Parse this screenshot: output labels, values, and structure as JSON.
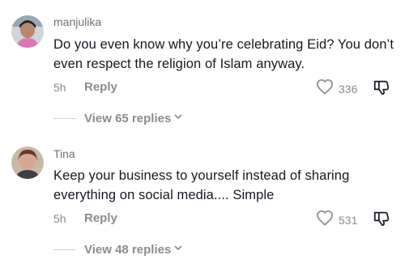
{
  "comments": [
    {
      "username": "manjulika",
      "text": "Do you even know why you’re celebrating Eid? You don’t even respect the religion of Islam anyway.",
      "time": "5h",
      "reply_label": "Reply",
      "likes": "336",
      "view_replies": "View 65 replies",
      "icons": [
        "heart-icon",
        "dislike-icon",
        "chevron-down-icon"
      ]
    },
    {
      "username": "Tina",
      "text": "Keep your business to yourself instead of sharing everything on social media.... Simple",
      "time": "5h",
      "reply_label": "Reply",
      "likes": "531",
      "view_replies": "View 48 replies",
      "icons": [
        "heart-icon",
        "dislike-icon",
        "chevron-down-icon"
      ]
    }
  ],
  "colors": {
    "text_primary": "#161823",
    "text_secondary": "#8a8b91"
  }
}
